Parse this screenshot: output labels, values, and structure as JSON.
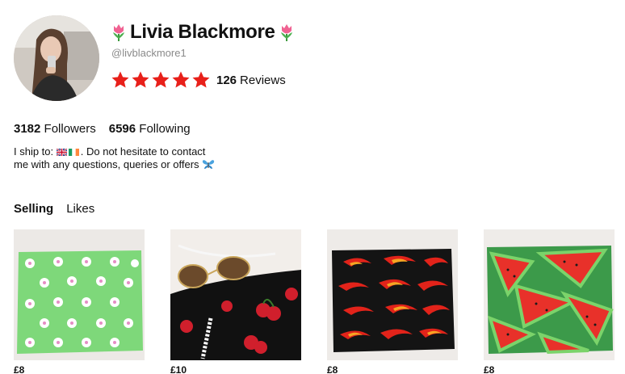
{
  "profile": {
    "name": "Livia Blackmore",
    "handle": "@livblackmore1",
    "rating_stars": 5,
    "review_count": "126",
    "review_label": "Reviews"
  },
  "stats": {
    "followers_count": "3182",
    "followers_label": "Followers",
    "following_count": "6596",
    "following_label": "Following"
  },
  "bio": {
    "ship_prefix": "I ship to:",
    "ship_suffix": ". Do not hesitate to contact",
    "line2": "me with any questions, queries or offers"
  },
  "tabs": [
    {
      "label": "Selling",
      "active": true
    },
    {
      "label": "Likes",
      "active": false
    }
  ],
  "items": [
    {
      "price": "£8",
      "image": "green-daisy-fabric"
    },
    {
      "price": "£10",
      "image": "cherry-fabric-sunglasses"
    },
    {
      "price": "£8",
      "image": "flame-fabric"
    },
    {
      "price": "£8",
      "image": "watermelon-fabric"
    }
  ],
  "colors": {
    "star": "#e8201a",
    "handle": "#8a8a8a"
  }
}
